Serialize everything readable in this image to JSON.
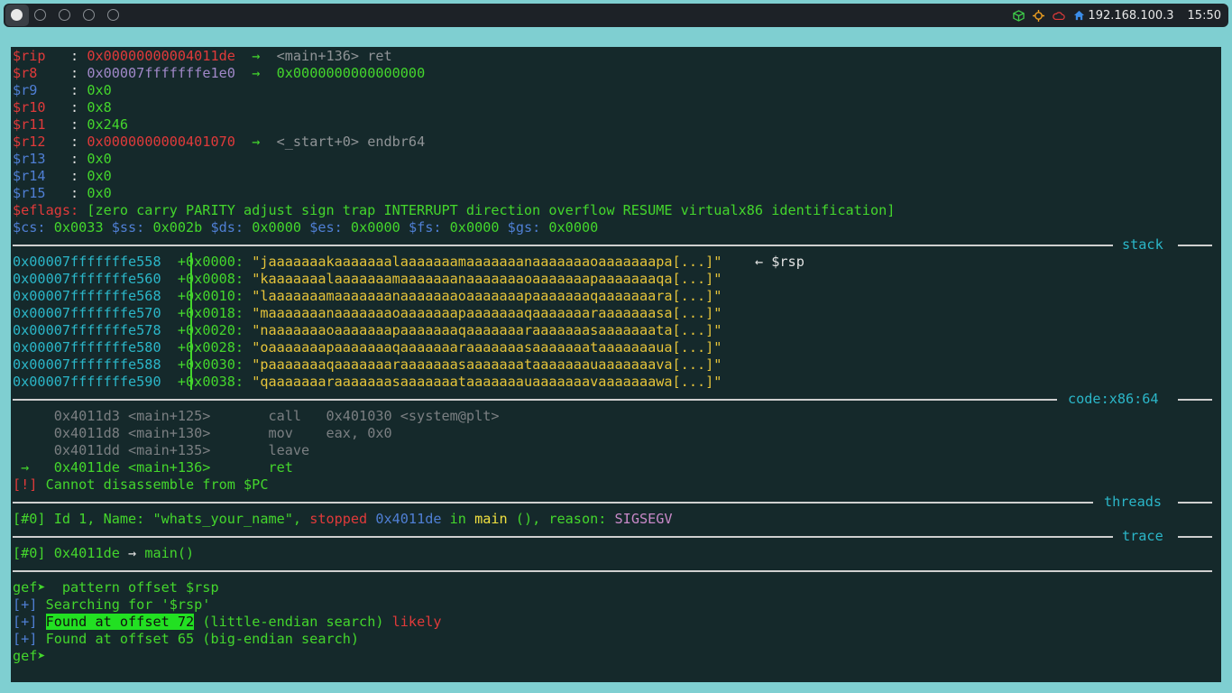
{
  "topbar": {
    "ip": "192.168.100.3",
    "time": "15:50"
  },
  "registers": [
    {
      "name": "$rip   ",
      "sep": ": ",
      "value": "0x00000000004011de",
      "arrow": "  →  ",
      "deref": "<main+136> ret"
    },
    {
      "name": "$r8    ",
      "sep": ": ",
      "value": "0x00007fffffffe1e0",
      "arrow": "  →  ",
      "deref": "0x0000000000000000"
    },
    {
      "name": "$r9    ",
      "sep": ": ",
      "value": "0x0"
    },
    {
      "name": "$r10   ",
      "sep": ": ",
      "value": "0x8"
    },
    {
      "name": "$r11   ",
      "sep": ": ",
      "value": "0x246"
    },
    {
      "name": "$r12   ",
      "sep": ": ",
      "value": "0x0000000000401070",
      "arrow": "  →  ",
      "deref": "<_start+0> endbr64"
    },
    {
      "name": "$r13   ",
      "sep": ": ",
      "value": "0x0"
    },
    {
      "name": "$r14   ",
      "sep": ": ",
      "value": "0x0"
    },
    {
      "name": "$r15   ",
      "sep": ": ",
      "value": "0x0"
    }
  ],
  "eflags": {
    "name": "$eflags:",
    "value": " [zero carry PARITY adjust sign trap INTERRUPT direction overflow RESUME virtualx86 identification]"
  },
  "segments": [
    {
      "name": "$cs:",
      "value": " 0x0033 "
    },
    {
      "name": "$ss:",
      "value": " 0x002b "
    },
    {
      "name": "$ds:",
      "value": " 0x0000 "
    },
    {
      "name": "$es:",
      "value": " 0x0000 "
    },
    {
      "name": "$fs:",
      "value": " 0x0000 "
    },
    {
      "name": "$gs:",
      "value": " 0x0000"
    }
  ],
  "sections": {
    "stack": "stack",
    "code": "code:x86:64",
    "threads": "threads",
    "trace": "trace"
  },
  "stack": [
    {
      "addr": "0x00007fffffffe558",
      "off": "+0x0000:",
      "val": "\"jaaaaaaakaaaaaaalaaaaaaamaaaaaaanaaaaaaaoaaaaaaapa[...]\"",
      "note": "    ← $rsp"
    },
    {
      "addr": "0x00007fffffffe560",
      "off": "+0x0008:",
      "val": "\"kaaaaaaalaaaaaaamaaaaaaanaaaaaaaoaaaaaaapaaaaaaaqa[...]\""
    },
    {
      "addr": "0x00007fffffffe568",
      "off": "+0x0010:",
      "val": "\"laaaaaaamaaaaaaanaaaaaaaoaaaaaaapaaaaaaaqaaaaaaara[...]\""
    },
    {
      "addr": "0x00007fffffffe570",
      "off": "+0x0018:",
      "val": "\"maaaaaaanaaaaaaaoaaaaaaapaaaaaaaqaaaaaaaraaaaaaasa[...]\""
    },
    {
      "addr": "0x00007fffffffe578",
      "off": "+0x0020:",
      "val": "\"naaaaaaaoaaaaaaapaaaaaaaqaaaaaaaraaaaaaasaaaaaaata[...]\""
    },
    {
      "addr": "0x00007fffffffe580",
      "off": "+0x0028:",
      "val": "\"oaaaaaaapaaaaaaaqaaaaaaaraaaaaaasaaaaaaataaaaaaaua[...]\""
    },
    {
      "addr": "0x00007fffffffe588",
      "off": "+0x0030:",
      "val": "\"paaaaaaaqaaaaaaaraaaaaaasaaaaaaataaaaaaauaaaaaaava[...]\""
    },
    {
      "addr": "0x00007fffffffe590",
      "off": "+0x0038:",
      "val": "\"qaaaaaaaraaaaaaasaaaaaaataaaaaaauaaaaaaavaaaaaaawa[...]\""
    }
  ],
  "code": [
    {
      "marker": "   ",
      "addr": "  0x4011d3 <main+125>",
      "ins": "       call   0x401030 <system@plt>"
    },
    {
      "marker": "   ",
      "addr": "  0x4011d8 <main+130>",
      "ins": "       mov    eax, 0x0"
    },
    {
      "marker": "   ",
      "addr": "  0x4011dd <main+135>",
      "ins": "       leave  "
    },
    {
      "marker": " → ",
      "addr": "  0x4011de <main+136>",
      "ins": "       ret    "
    }
  ],
  "code_error": {
    "tag": "[!]",
    "msg": " Cannot disassemble from $PC"
  },
  "thread": {
    "idx": "[#0]",
    "id": " Id 1, Name: \"whats_your_name\", ",
    "state": "stopped",
    "addr": " 0x4011de",
    "in": " in ",
    "func": "main",
    "reason_label": " (), reason: ",
    "reason": "SIGSEGV"
  },
  "trace": {
    "idx": "[#0]",
    "addr": " 0x4011de",
    "arrow": " → ",
    "func": "main()"
  },
  "prompt": {
    "ps1": "gef➤ ",
    "cmd": " pattern offset $rsp",
    "lines": [
      {
        "tag": "[+]",
        "text": " Searching for '$rsp'"
      },
      {
        "tag": "[+]",
        "pre": " ",
        "hl": "Found at offset 72",
        "text": " (little-endian search) ",
        "extra": "likely"
      },
      {
        "tag": "[+]",
        "text": " Found at offset 65 (big-endian search)"
      }
    ],
    "final": "gef➤"
  }
}
